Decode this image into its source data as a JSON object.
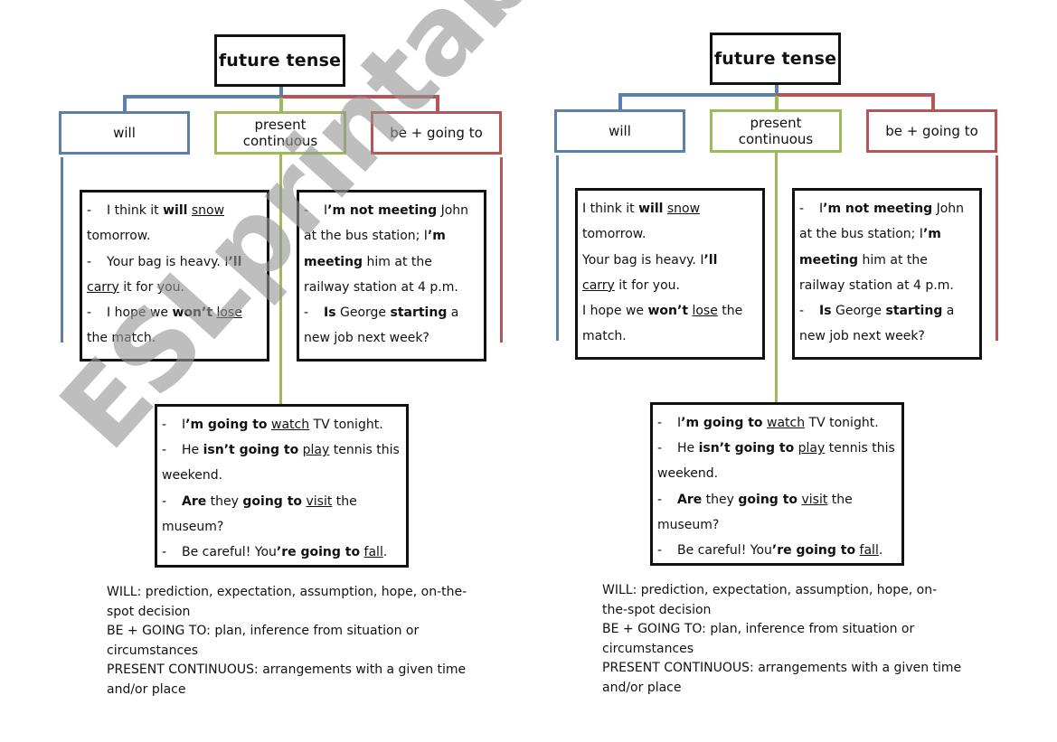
{
  "watermark": "ESLprintables.com",
  "colors": {
    "will": "#5b80ad",
    "present_continuous": "#9bbb59",
    "going_to": "#b65555",
    "title_border": "#111111"
  },
  "diagrams": [
    {
      "title": "future tense",
      "categories": {
        "will": "will",
        "present_continuous": [
          "present",
          "continuous"
        ],
        "going_to": "be + going to"
      },
      "will_examples": [
        {
          "dash": "-",
          "parts": [
            [
              "I think it ",
              ""
            ],
            [
              "will",
              "b"
            ],
            [
              " ",
              ""
            ],
            [
              "snow",
              "u"
            ]
          ]
        },
        {
          "dash": "",
          "parts": [
            [
              "tomorrow.",
              ""
            ]
          ]
        },
        {
          "dash": "-",
          "parts": [
            [
              "Your bag is heavy. I",
              ""
            ],
            [
              "’ll",
              "b"
            ]
          ]
        },
        {
          "dash": "",
          "parts": [
            [
              "carry",
              "u"
            ],
            [
              " it for you.",
              ""
            ]
          ]
        },
        {
          "dash": "-",
          "parts": [
            [
              "I hope we ",
              ""
            ],
            [
              "won’t",
              "b"
            ],
            [
              " ",
              ""
            ],
            [
              "lose",
              "u"
            ]
          ]
        },
        {
          "dash": "",
          "parts": [
            [
              "the match.",
              ""
            ]
          ]
        }
      ],
      "present_continuous_examples": [
        {
          "dash": "-",
          "parts": [
            [
              "I",
              ""
            ],
            [
              "’m not meeting",
              "b"
            ],
            [
              " John",
              ""
            ]
          ]
        },
        {
          "dash": "",
          "parts": [
            [
              "at the bus station; I",
              ""
            ],
            [
              "’m",
              "b"
            ]
          ]
        },
        {
          "dash": "",
          "parts": [
            [
              "meeting",
              "b"
            ],
            [
              " him at the",
              ""
            ]
          ]
        },
        {
          "dash": "",
          "parts": [
            [
              "railway station at 4 p.m.",
              ""
            ]
          ]
        },
        {
          "dash": "-",
          "parts": [
            [
              "Is",
              "b"
            ],
            [
              " George ",
              ""
            ],
            [
              "starting",
              "b"
            ],
            [
              " a",
              ""
            ]
          ]
        },
        {
          "dash": "",
          "parts": [
            [
              "new job next week?",
              ""
            ]
          ]
        }
      ],
      "going_to_examples": [
        {
          "dash": "-",
          "parts": [
            [
              "I",
              ""
            ],
            [
              "’m going to",
              "b"
            ],
            [
              " ",
              ""
            ],
            [
              "watch",
              "u"
            ],
            [
              " TV tonight.",
              ""
            ]
          ]
        },
        {
          "dash": "-",
          "parts": [
            [
              "He ",
              ""
            ],
            [
              "isn’t going to",
              "b"
            ],
            [
              " ",
              ""
            ],
            [
              "play",
              "u"
            ],
            [
              " tennis this",
              ""
            ]
          ]
        },
        {
          "dash": "",
          "parts": [
            [
              "weekend.",
              ""
            ]
          ]
        },
        {
          "dash": "-",
          "parts": [
            [
              "Are",
              "b"
            ],
            [
              " they ",
              ""
            ],
            [
              "going to",
              "b"
            ],
            [
              " ",
              ""
            ],
            [
              "visit",
              "u"
            ],
            [
              " the",
              ""
            ]
          ]
        },
        {
          "dash": "",
          "parts": [
            [
              "museum?",
              ""
            ]
          ]
        },
        {
          "dash": "-",
          "parts": [
            [
              "Be careful! You",
              ""
            ],
            [
              "’re going to",
              "b"
            ],
            [
              " ",
              ""
            ],
            [
              "fall",
              "u"
            ],
            [
              ".",
              ""
            ]
          ]
        }
      ],
      "notes": [
        "WILL: prediction, expectation, assumption, hope, on-the-",
        "spot decision",
        "BE + GOING TO: plan, inference from situation or",
        "circumstances",
        "PRESENT CONTINUOUS: arrangements with a given time",
        "and/or place"
      ]
    },
    {
      "title": "future tense",
      "categories": {
        "will": "will",
        "present_continuous": [
          "present",
          "continuous"
        ],
        "going_to": "be + going to"
      },
      "will_examples": [
        {
          "dash": "",
          "parts": [
            [
              "I think it ",
              ""
            ],
            [
              "will",
              "b"
            ],
            [
              " ",
              ""
            ],
            [
              "snow",
              "u"
            ]
          ]
        },
        {
          "dash": "",
          "parts": [
            [
              "tomorrow.",
              ""
            ]
          ]
        },
        {
          "dash": "",
          "parts": [
            [
              "Your bag is heavy. I",
              ""
            ],
            [
              "’ll",
              "b"
            ]
          ]
        },
        {
          "dash": "",
          "parts": [
            [
              "carry",
              "u"
            ],
            [
              " it for you.",
              ""
            ]
          ]
        },
        {
          "dash": "",
          "parts": [
            [
              "I hope we ",
              ""
            ],
            [
              "won’t",
              "b"
            ],
            [
              " ",
              ""
            ],
            [
              "lose",
              "u"
            ],
            [
              " the",
              ""
            ]
          ]
        },
        {
          "dash": "",
          "parts": [
            [
              "match.",
              ""
            ]
          ]
        }
      ],
      "present_continuous_examples": [
        {
          "dash": "-",
          "parts": [
            [
              "I",
              ""
            ],
            [
              "’m not meeting",
              "b"
            ],
            [
              " John",
              ""
            ]
          ]
        },
        {
          "dash": "",
          "parts": [
            [
              "at the bus station; I",
              ""
            ],
            [
              "’m",
              "b"
            ]
          ]
        },
        {
          "dash": "",
          "parts": [
            [
              "meeting",
              "b"
            ],
            [
              " him at the",
              ""
            ]
          ]
        },
        {
          "dash": "",
          "parts": [
            [
              "railway station at 4 p.m.",
              ""
            ]
          ]
        },
        {
          "dash": "-",
          "parts": [
            [
              "Is",
              "b"
            ],
            [
              " George ",
              ""
            ],
            [
              "starting",
              "b"
            ],
            [
              " a",
              ""
            ]
          ]
        },
        {
          "dash": "",
          "parts": [
            [
              "new job next week?",
              ""
            ]
          ]
        }
      ],
      "going_to_examples": [
        {
          "dash": "-",
          "parts": [
            [
              "I",
              ""
            ],
            [
              "’m going to",
              "b"
            ],
            [
              " ",
              ""
            ],
            [
              "watch",
              "u"
            ],
            [
              " TV tonight.",
              ""
            ]
          ]
        },
        {
          "dash": "-",
          "parts": [
            [
              "He ",
              ""
            ],
            [
              "isn’t going to",
              "b"
            ],
            [
              " ",
              ""
            ],
            [
              "play",
              "u"
            ],
            [
              " tennis this",
              ""
            ]
          ]
        },
        {
          "dash": "",
          "parts": [
            [
              "weekend.",
              ""
            ]
          ]
        },
        {
          "dash": "-",
          "parts": [
            [
              "Are",
              "b"
            ],
            [
              " they ",
              ""
            ],
            [
              "going to",
              "b"
            ],
            [
              " ",
              ""
            ],
            [
              "visit",
              "u"
            ],
            [
              " the",
              ""
            ]
          ]
        },
        {
          "dash": "",
          "parts": [
            [
              "museum?",
              ""
            ]
          ]
        },
        {
          "dash": "-",
          "parts": [
            [
              "Be careful! You",
              ""
            ],
            [
              "’re going to",
              "b"
            ],
            [
              " ",
              ""
            ],
            [
              "fall",
              "u"
            ],
            [
              ".",
              ""
            ]
          ]
        }
      ],
      "notes": [
        "WILL: prediction, expectation, assumption, hope, on-",
        "the-spot decision",
        "BE + GOING TO: plan, inference from situation or",
        "circumstances",
        "PRESENT CONTINUOUS: arrangements with a given time",
        "and/or place"
      ]
    }
  ]
}
